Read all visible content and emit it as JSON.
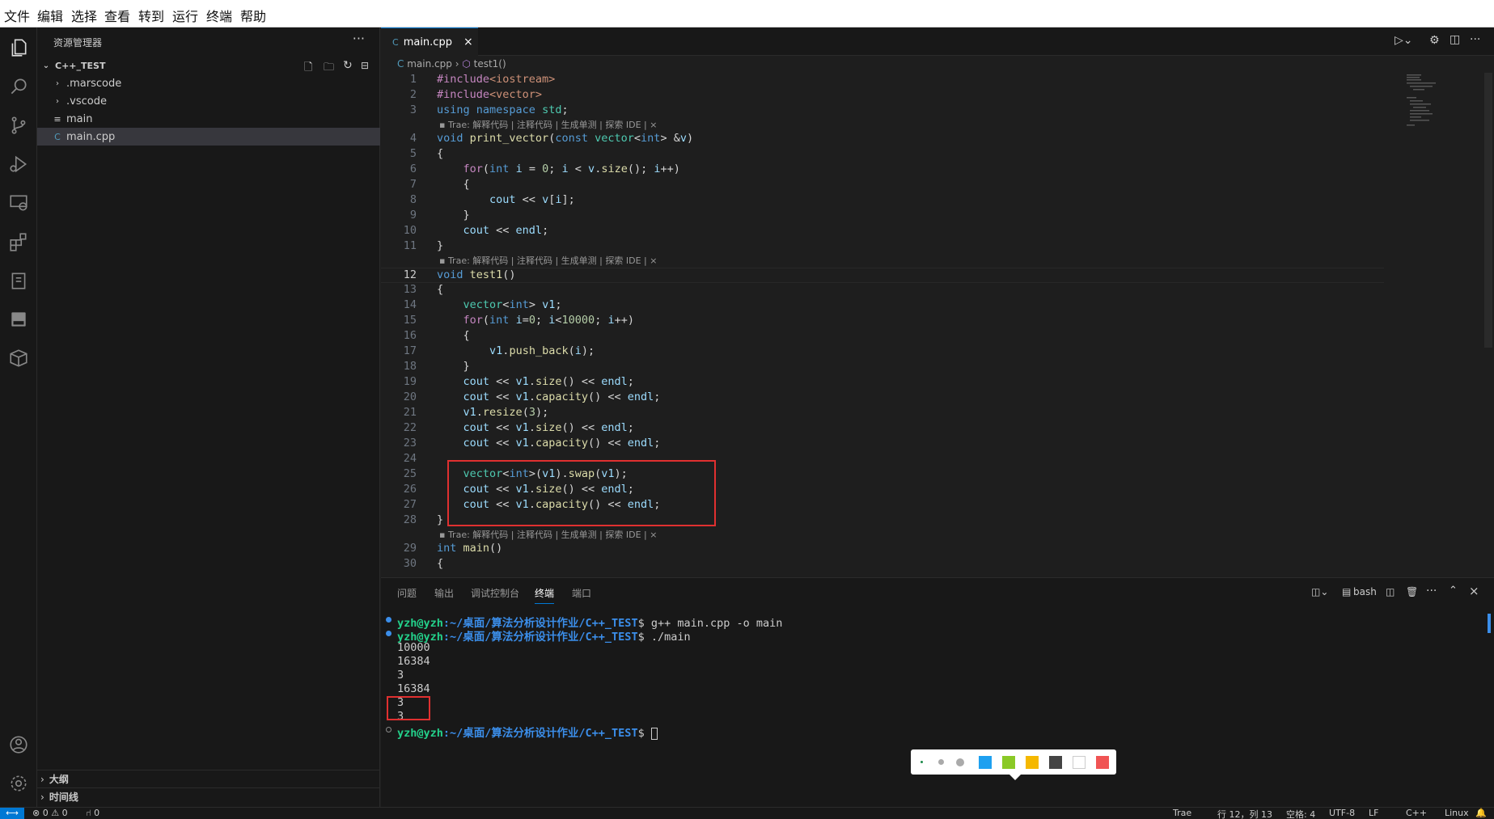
{
  "menu": [
    "文件",
    "编辑",
    "选择",
    "查看",
    "转到",
    "运行",
    "终端",
    "帮助"
  ],
  "sidebar": {
    "title": "资源管理器",
    "more": "···",
    "project": "C++_TEST",
    "items": [
      {
        "label": ".marscode",
        "kind": "folder"
      },
      {
        "label": ".vscode",
        "kind": "folder"
      },
      {
        "label": "main",
        "kind": "file"
      },
      {
        "label": "main.cpp",
        "kind": "cpp",
        "selected": true
      }
    ],
    "outline": "大纲",
    "timeline": "时间线"
  },
  "editor": {
    "tab_label": "main.cpp",
    "breadcrumb_file": "main.cpp",
    "breadcrumb_symbol": "test1()",
    "codelens": "Trae: 解释代码 | 注释代码 | 生成单测 | 探索 IDE | ×",
    "current_line": 12,
    "lines": [
      "#include<iostream>",
      "#include<vector>",
      "using namespace std;",
      "void print_vector(const vector<int> &v)",
      "{",
      "    for(int i = 0; i < v.size(); i++)",
      "    {",
      "        cout << v[i];",
      "    }",
      "    cout << endl;",
      "}",
      "void test1()",
      "{",
      "    vector<int> v1;",
      "    for(int i=0; i<10000; i++)",
      "    {",
      "        v1.push_back(i);",
      "    }",
      "    cout << v1.size() << endl;",
      "    cout << v1.capacity() << endl;",
      "    v1.resize(3);",
      "    cout << v1.size() << endl;",
      "    cout << v1.capacity() << endl;",
      "",
      "    vector<int>(v1).swap(v1);",
      "    cout << v1.size() << endl;",
      "    cout << v1.capacity() << endl;",
      "}",
      "int main()",
      "{"
    ]
  },
  "panel": {
    "tabs": [
      "问题",
      "输出",
      "调试控制台",
      "终端",
      "端口"
    ],
    "active_tab": "终端",
    "shell": "bash",
    "prompt_user": "yzh@yzh",
    "prompt_path": ":~/桌面/算法分析设计作业/C++_TEST",
    "commands": [
      "$ g++ main.cpp -o main",
      "$ ./main",
      "$ "
    ],
    "output": [
      "10000",
      "16384",
      "3",
      "16384",
      "3",
      "3"
    ]
  },
  "palette_colors": [
    "#1ea0f0",
    "#8ac926",
    "#f5b800",
    "#444444",
    "#ffffff",
    "#f05454"
  ],
  "status": {
    "problems": "⊗ 0 ⚠ 0",
    "ports": "⑁ 0",
    "trae": "Trae",
    "position": "行 12，列 13",
    "spaces": "空格: 4",
    "encoding": "UTF-8",
    "eol": "LF",
    "language": "C++",
    "os": "Linux"
  }
}
